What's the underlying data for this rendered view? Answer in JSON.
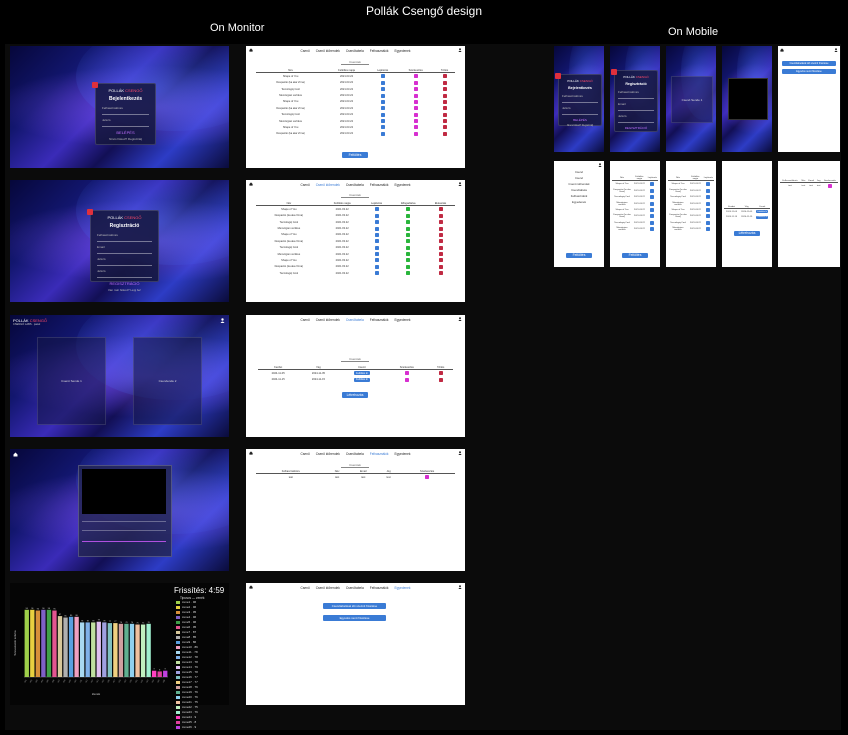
{
  "title": "Pollák Csengő design",
  "sections": {
    "monitor": "On Monitor",
    "mobile": "On Mobile"
  },
  "nav": {
    "items": [
      "Csenő",
      "Csenő időrendek",
      "Csenőtabela",
      "Felhasználók",
      "Egyedenek"
    ]
  },
  "login": {
    "brand": "POLLÁK",
    "brand_accent": "CSENGŐ",
    "heading": "Bejelentkezés",
    "username_label": "Felhasználónév",
    "password_label": "Jelszó",
    "button": "BELÉPÉS",
    "footer": "Nincs fiókod? Regisztrálj"
  },
  "register": {
    "brand": "POLLÁK",
    "brand_accent": "CSENGŐ",
    "heading": "Regisztráció",
    "username_label": "Felhasználónév",
    "email_label": "Email",
    "password_label": "Jelszó",
    "password2_label": "Jelszó",
    "button": "REGISZTRÁCIÓ",
    "footer": "Van már fiókod? Lépj be!"
  },
  "picker": {
    "brand": "POLLÁK",
    "brand_accent": "CSENGŐ",
    "subtitle": "CSENGŐ LABS · panel",
    "left": "Csenő Sende 1",
    "right": "Csenőende 2"
  },
  "songs_table": {
    "tab": "Csenőek",
    "headers": [
      "Név",
      "Feltöltés napja",
      "Lejátszás",
      "Szerkesztés",
      "Törlés"
    ],
    "rows": [
      [
        "Shape of You",
        "2021.03.22"
      ],
      [
        "Despacito (ka aka Vrma)",
        "2021.03.22"
      ],
      [
        "Tecnologiq Cool",
        "2021.03.22"
      ],
      [
        "Memórgian vertikus",
        "2021.03.22"
      ],
      [
        "Shape of You",
        "2021.03.22"
      ],
      [
        "Despacito (ka aka Vrma)",
        "2021.03.22"
      ],
      [
        "Tecnologiq Cool",
        "2021.03.22"
      ],
      [
        "Memórgian vertikus",
        "2021.03.22"
      ],
      [
        "Shape of You",
        "2021.03.22"
      ],
      [
        "Despacito (ka aka Vrma)",
        "2021.03.22"
      ]
    ],
    "button": "Feltöltés"
  },
  "schedule_table": {
    "tab": "Csenőek",
    "headers": [
      "Név",
      "Feltöltés napja",
      "Lejátszás",
      "Elfogadtatva",
      "Elutasítás"
    ],
    "rows": [
      [
        "Shape of You",
        "2021.03.22"
      ],
      [
        "Despacito (ka aka Vrma)",
        "2021.03.22"
      ],
      [
        "Tecnologiq Cool",
        "2021.03.22"
      ],
      [
        "Memórgian vertikus",
        "2021.03.22"
      ],
      [
        "Shape of You",
        "2021.03.22"
      ],
      [
        "Despacito (ka aka Vrma)",
        "2021.03.22"
      ],
      [
        "Tecnologiq Cool",
        "2021.03.22"
      ],
      [
        "Memórgian vertikus",
        "2021.03.22"
      ],
      [
        "Shape of You",
        "2021.03.22"
      ],
      [
        "Despacito (ka aka Vrma)",
        "2021.03.22"
      ],
      [
        "Tecnologiq Cool",
        "2021.03.22"
      ]
    ]
  },
  "tabela": {
    "tab": "Csenőek",
    "headers": [
      "Kezdet",
      "Vég",
      "Csenő",
      "Szerkesztés",
      "Törlés"
    ],
    "rows": [
      [
        "2024-11-05",
        "2024-11-05",
        "Feltöltés ki"
      ],
      [
        "2024-11-15",
        "2024-11-15",
        "Feltöltés ki"
      ]
    ],
    "button": "Létrehozás"
  },
  "users": {
    "tab": "Csenőek",
    "headers": [
      "Felhasználónév",
      "Név",
      "Email",
      "Jog",
      "Szerkesztés"
    ],
    "row": [
      "test",
      "test",
      "test",
      "test"
    ]
  },
  "settings": {
    "btn1": "Csenőtabelával idő szerinti frissítése",
    "btn2": "Egyedos nenű frissítése"
  },
  "vote": {
    "refresh": "Frissítés: 4:59",
    "legend_title": "Tipusos — zenék"
  },
  "chart_data": {
    "type": "bar",
    "ylabel": "Szavazatok száma",
    "xlabel": "Zenék",
    "categories": [
      "s01",
      "s02",
      "s03",
      "s04",
      "s05",
      "s06",
      "s07",
      "s08",
      "s09",
      "s10",
      "s11",
      "s12",
      "s13",
      "s14",
      "s15",
      "s16",
      "s17",
      "s18",
      "s19",
      "s20",
      "s21",
      "s22",
      "s23",
      "s24",
      "s25",
      "s26"
    ],
    "values": [
      96,
      96,
      95,
      96,
      96,
      95,
      87,
      85,
      86,
      86,
      78,
      78,
      78,
      79,
      78,
      77,
      77,
      76,
      76,
      76,
      75,
      75,
      76,
      9,
      8,
      9
    ],
    "colors": [
      "#9fd04a",
      "#e8d040",
      "#d7903a",
      "#7f60c7",
      "#3f9f48",
      "#e35590",
      "#d7c79a",
      "#b0b0b0",
      "#5aa0e0",
      "#f0a0c0",
      "#a8d8f0",
      "#7fb0e8",
      "#c0e0a0",
      "#e0c0f0",
      "#a0a0e0",
      "#80c0c0",
      "#f0d080",
      "#d0a0a0",
      "#60b090",
      "#90d0f0",
      "#f0c0a0",
      "#c0f0c0",
      "#a0f0d0",
      "#ff40c0",
      "#e040a0",
      "#c040e0"
    ],
    "ylim": [
      0,
      100
    ]
  },
  "legend_items": [
    "zene1 · 96",
    "zene2 · 96",
    "zene3 · 95",
    "zene4 · 96",
    "zene5 · 96",
    "zene6 · 95",
    "zene7 · 87",
    "zene8 · 85",
    "zene9 · 86",
    "zene10 · 86",
    "zene11 · 78",
    "zene12 · 78",
    "zene13 · 78",
    "zene14 · 79",
    "zene15 · 78",
    "zene16 · 77",
    "zene17 · 77",
    "zene18 · 76",
    "zene19 · 76",
    "zene20 · 76",
    "zene21 · 75",
    "zene22 · 75",
    "zene23 · 76",
    "zene24 · 9",
    "zene25 · 8",
    "zene26 · 9"
  ],
  "mobile": {
    "menu": [
      "Csenő",
      "Csenő",
      "Csenő időrendek",
      "Csenőtabela",
      "Felhasználók",
      "Egyedenek"
    ],
    "upload": "Feltöltés",
    "create": "Létrehozás",
    "settings_btn1": "Csenőtabelával idő szerinti frissítése",
    "settings_btn2": "Egyedos nenű frissítése"
  }
}
